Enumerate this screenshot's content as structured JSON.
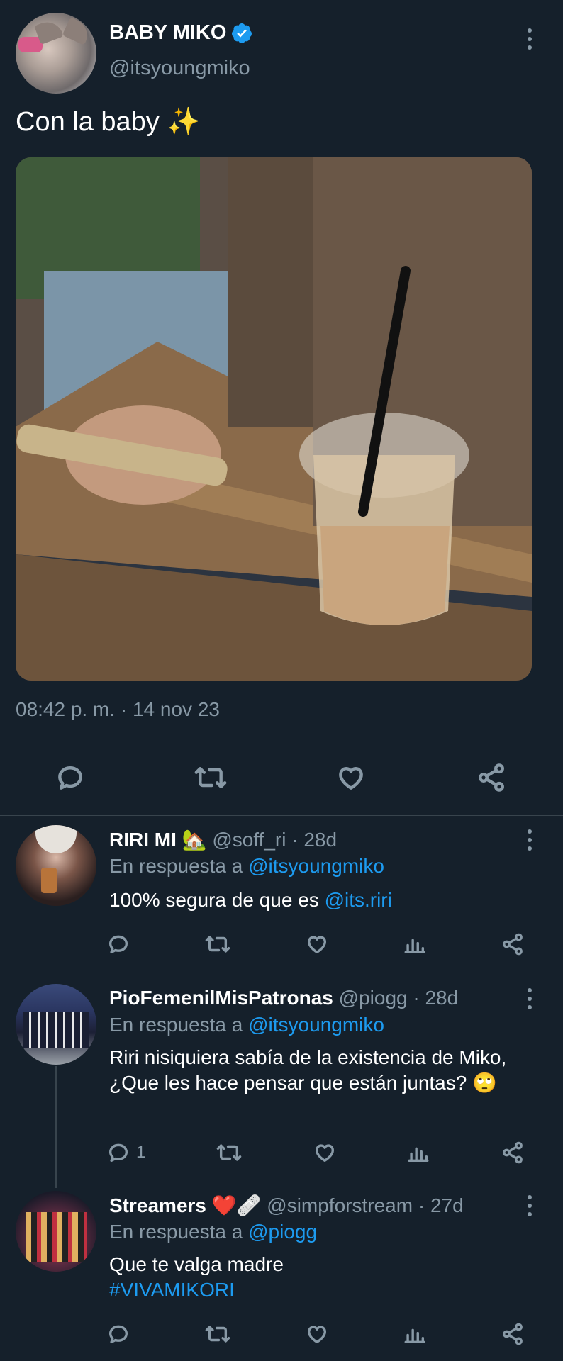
{
  "main_tweet": {
    "name": "BABY MIKO",
    "handle": "@itsyoungmiko",
    "text": "Con la baby ✨",
    "timestamp": "08:42 p. m. · 14 nov 23"
  },
  "replies": [
    {
      "name": "RIRI MI 🏡",
      "handle": "@soff_ri · 28d",
      "reply_to_prefix": "En respuesta a ",
      "reply_to": "@itsyoungmiko",
      "text": "100% segura de que es ",
      "text_link": "@its.riri",
      "reply_count": ""
    },
    {
      "name": "PioFemenilMisPatronas",
      "handle": "@piogg · 28d",
      "reply_to_prefix": "En respuesta a ",
      "reply_to": "@itsyoungmiko",
      "text": "Riri nisiquiera sabía de la existencia de Miko, ¿Que les hace pensar que están juntas? 🙄",
      "reply_count": "1"
    },
    {
      "name": "Streamers ❤️🩹",
      "handle": "@simpforstream · 27d",
      "reply_to_prefix": "En respuesta a ",
      "reply_to": "@piogg",
      "text": "Que te valga madre",
      "hashtag": "#VIVAMIKORI",
      "reply_count": ""
    }
  ],
  "colors": {
    "background": "#15202b",
    "muted": "#8899a6",
    "link": "#1d9bf0",
    "divider": "#38444d"
  }
}
